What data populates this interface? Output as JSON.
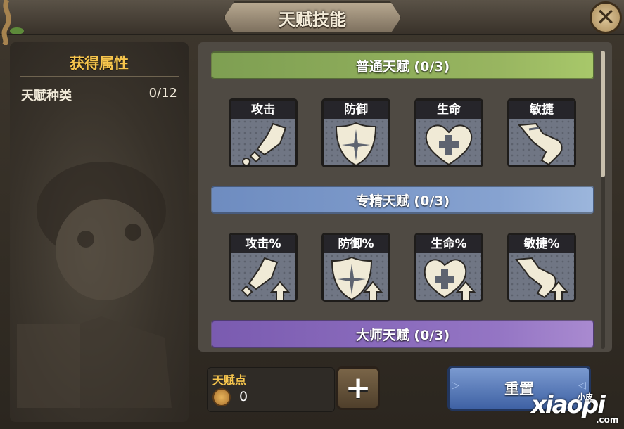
{
  "window": {
    "title": "天赋技能"
  },
  "attributes": {
    "heading": "获得属性",
    "row_label": "天赋种类",
    "row_value": "0/12"
  },
  "sections": [
    {
      "title": "普通天赋 (0/3)",
      "skills": [
        "攻击",
        "防御",
        "生命",
        "敏捷"
      ]
    },
    {
      "title": "专精天赋 (0/3)",
      "skills": [
        "攻击%",
        "防御%",
        "生命%",
        "敏捷%"
      ]
    },
    {
      "title": "大师天赋 (0/3)"
    }
  ],
  "points": {
    "label": "天赋点",
    "value": "0"
  },
  "buttons": {
    "add": "+",
    "reset": "重置",
    "close": "✕"
  },
  "watermark": {
    "main": "xiaopi",
    "small": "小皮",
    "suffix": ".com"
  },
  "colors": {
    "normal": "#98b560",
    "expert": "#86a2d0",
    "master": "#9475c4",
    "gold": "#f6c54d"
  }
}
